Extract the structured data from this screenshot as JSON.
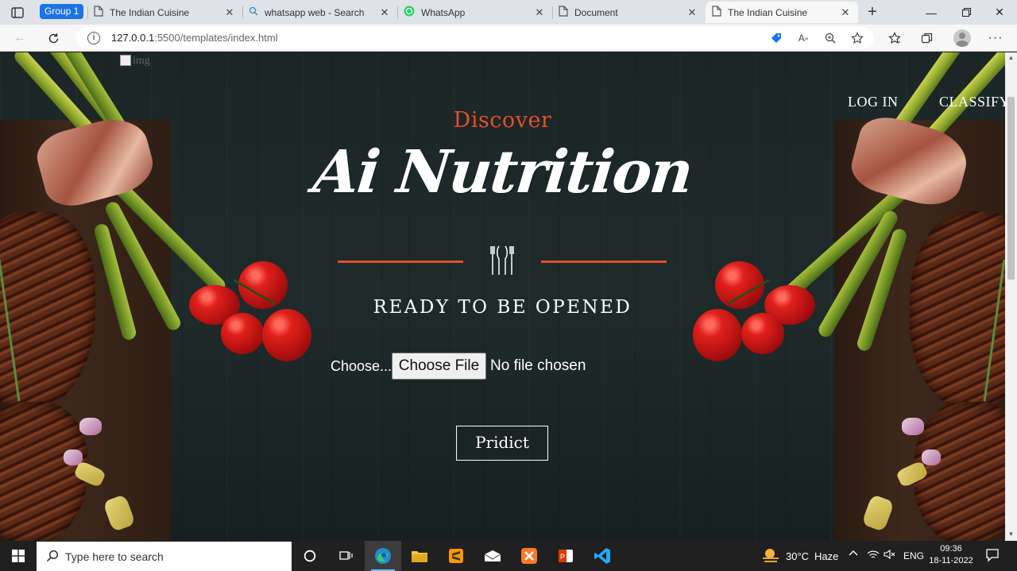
{
  "browser": {
    "group_label": "Group 1",
    "tabs": [
      {
        "title": "The Indian Cuisine",
        "icon": "page-icon"
      },
      {
        "title": "whatsapp web - Search",
        "icon": "search-icon"
      },
      {
        "title": "WhatsApp",
        "icon": "whatsapp-icon"
      },
      {
        "title": "Document",
        "icon": "page-icon"
      },
      {
        "title": "The Indian Cuisine",
        "icon": "page-icon",
        "active": true
      }
    ],
    "close_glyph": "✕",
    "url_host": "127.0.0.1",
    "url_rest": ":5500/templates/index.html"
  },
  "page": {
    "broken_image_alt": "img",
    "nav": {
      "login": "LOG IN",
      "classify": "CLASSIFY"
    },
    "discover": "Discover",
    "title": "Ai Nutrition",
    "subtitle": "READY TO BE OPENED",
    "choose_label": "Choose...",
    "file_button": "Choose File",
    "file_status": "No file chosen",
    "predict_button": "Pridict",
    "accent_color": "#e2502c"
  },
  "taskbar": {
    "search_placeholder": "Type here to search",
    "weather_temp": "30°C",
    "weather_desc": "Haze",
    "language": "ENG",
    "time": "09:36",
    "date": "18-11-2022"
  }
}
